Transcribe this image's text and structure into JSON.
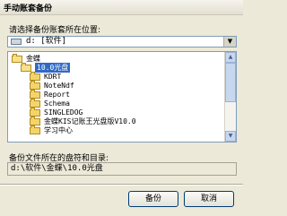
{
  "window": {
    "title": "手动账套备份"
  },
  "prompt": "请选择备份账套所在位置:",
  "dropdown": {
    "value": "d: [软件]"
  },
  "tree": {
    "items": [
      {
        "label": "金蝶",
        "open": true
      },
      {
        "label": "10.0光盘",
        "selected": true,
        "open": true
      },
      {
        "label": "KDRT"
      },
      {
        "label": "NoteNdf"
      },
      {
        "label": "Report"
      },
      {
        "label": "Schema"
      },
      {
        "label": "SINGLEDOG"
      },
      {
        "label": "金蝶KIS记账王光盘版V10.0"
      },
      {
        "label": "学习中心"
      }
    ]
  },
  "path_label": "备份文件所在的盘符和目录:",
  "path_value": "d:\\软件\\金蝶\\10.0光盘",
  "buttons": {
    "ok": "备份",
    "cancel": "取消"
  }
}
